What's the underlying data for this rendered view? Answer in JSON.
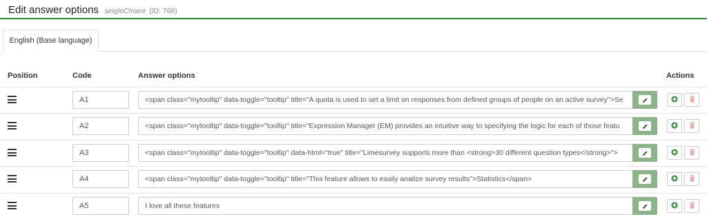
{
  "header": {
    "title": "Edit answer options",
    "question_type": "singleChoice",
    "question_id": "(ID: 766)"
  },
  "tabs": [
    {
      "label": "English (Base language)"
    }
  ],
  "table": {
    "columns": {
      "position": "Position",
      "code": "Code",
      "answer": "Answer options",
      "actions": "Actions"
    },
    "rows": [
      {
        "code": "A1",
        "answer": "<span class=\"mytooltip\" data-toggle=\"tooltip\" title=\"A quota is used to set a limit on responses from defined groups of people on an active survey\">Se"
      },
      {
        "code": "A2",
        "answer": "<span class=\"mytooltip\" data-toggle=\"tooltip\" title=\"Expression Manager (EM) provides an intuitive way to specifying the logic for each of those featu"
      },
      {
        "code": "A3",
        "answer": "<span class=\"mytooltip\" data-toggle=\"tooltip\" data-html=\"true\" title=\"Limesurvey supports more than <strong>30 different question types</strong>\">"
      },
      {
        "code": "A4",
        "answer": "<span class=\"mytooltip\" data-toggle=\"tooltip\" title=\"This feature allows to easily analize survey results\">Statistics</span>"
      },
      {
        "code": "A5",
        "answer": "I love all these features"
      }
    ]
  },
  "icons": {
    "drag": "drag-handle-icon",
    "edit": "pencil-icon",
    "add": "plus-circle-icon",
    "delete": "trash-icon"
  },
  "colors": {
    "accent_green": "#328637",
    "edit_button": "#8db38a",
    "add_icon": "#328637",
    "delete_icon": "#e8a9a9"
  }
}
